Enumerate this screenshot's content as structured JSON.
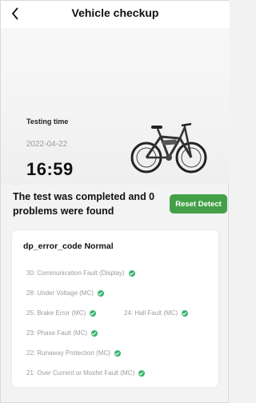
{
  "header": {
    "title": "Vehicle checkup",
    "back_icon": "chevron-left-icon"
  },
  "test": {
    "label": "Testing time",
    "date": "2022-04-22",
    "time": "16:59"
  },
  "summary": {
    "text": "The test was completed and 0 problems were found",
    "reset_label": "Reset Detect"
  },
  "card": {
    "title": "dp_error_code Normal",
    "items": [
      {
        "label": "30:  Communication Fault (Display)"
      },
      {
        "label": "28: Under Voltage (MC)"
      },
      {
        "label": "25: Brake Error (MC)"
      },
      {
        "label": "24: Hall Fault (MC)"
      },
      {
        "label": "23:  Phase Fault (MC)"
      },
      {
        "label": "22: Runaway Protection (MC)"
      },
      {
        "label": "21:  Over Current or Mosfet Fault (MC)"
      }
    ]
  },
  "colors": {
    "accent": "#43a047",
    "ok": "#39b56f"
  }
}
